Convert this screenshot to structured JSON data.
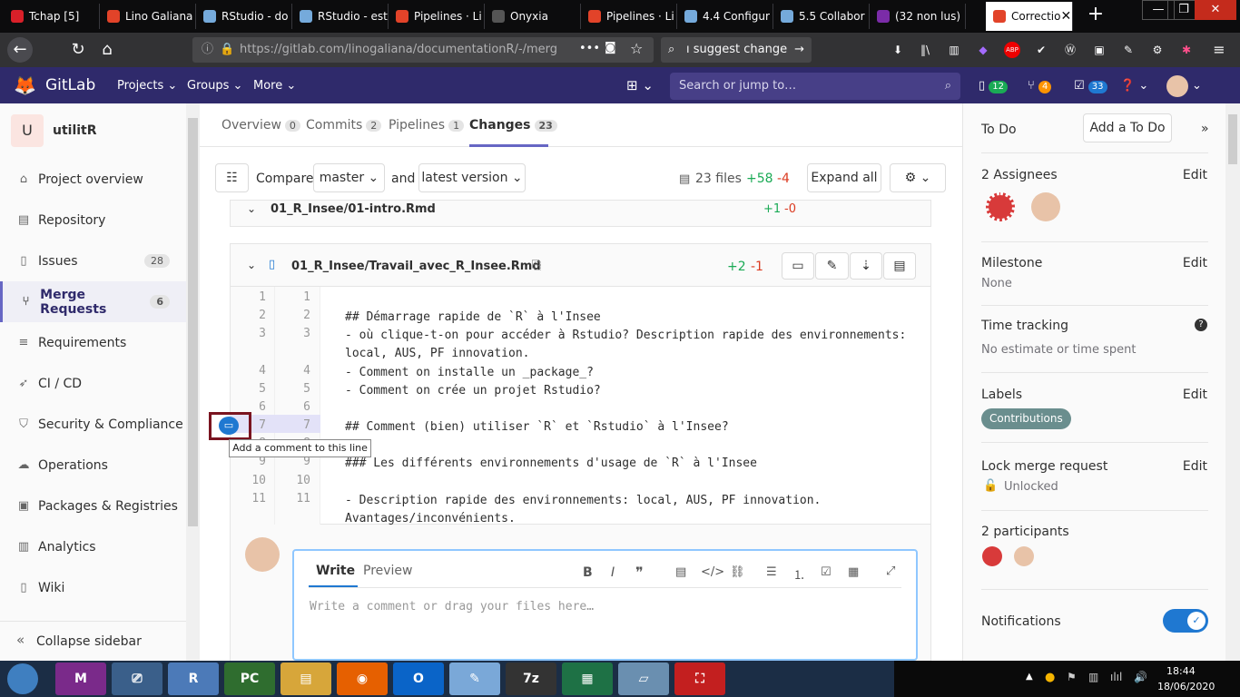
{
  "browser": {
    "tabs": [
      {
        "label": "Tchap [5]",
        "icon": "tchap-icon",
        "color": "#d92029"
      },
      {
        "label": "Lino Galiana",
        "icon": "gitlab-icon",
        "color": "#e24329"
      },
      {
        "label": "RStudio - do",
        "icon": "rstudio-icon",
        "color": "#75aadb"
      },
      {
        "label": "RStudio - est",
        "icon": "rstudio-icon",
        "color": "#75aadb"
      },
      {
        "label": "Pipelines · Li",
        "icon": "gitlab-icon",
        "color": "#e24329"
      },
      {
        "label": "Onyxia",
        "icon": "onyxia-icon",
        "color": "#555555"
      },
      {
        "label": "Pipelines · Li",
        "icon": "gitlab-icon",
        "color": "#e24329"
      },
      {
        "label": "4.4 Configur",
        "icon": "rstudio-icon",
        "color": "#75aadb"
      },
      {
        "label": "5.5 Collabor",
        "icon": "rstudio-icon",
        "color": "#75aadb"
      },
      {
        "label": "(32 non lus)",
        "icon": "mail-icon",
        "color": "#7b2ca8"
      },
      {
        "label": "Correctio",
        "icon": "gitlab-icon",
        "color": "#e24329"
      }
    ],
    "url": "https://gitlab.com/linogaliana/documentationR/-/merg",
    "url_host": "gitlab.com",
    "search": "ı suggest change"
  },
  "gitlab": {
    "brand": "GitLab",
    "nav": [
      "Projects",
      "Groups",
      "More"
    ],
    "search_placeholder": "Search or jump to…",
    "counts": {
      "mr": "12",
      "issues": "4",
      "todos": "33"
    }
  },
  "sidebar": {
    "project_initial": "U",
    "project": "utilitR",
    "items": [
      {
        "label": "Project overview",
        "icon": "home-icon"
      },
      {
        "label": "Repository",
        "icon": "doc-icon"
      },
      {
        "label": "Issues",
        "icon": "issues-icon",
        "badge": "28"
      },
      {
        "label": "Merge Requests",
        "icon": "merge-icon",
        "badge": "6",
        "active": true
      },
      {
        "label": "Requirements",
        "icon": "list-icon"
      },
      {
        "label": "CI / CD",
        "icon": "rocket-icon"
      },
      {
        "label": "Security & Compliance",
        "icon": "shield-icon"
      },
      {
        "label": "Operations",
        "icon": "cloud-icon"
      },
      {
        "label": "Packages & Registries",
        "icon": "package-icon"
      },
      {
        "label": "Analytics",
        "icon": "chart-icon"
      },
      {
        "label": "Wiki",
        "icon": "book-icon"
      }
    ],
    "collapse": "Collapse sidebar"
  },
  "mr": {
    "tabs": [
      {
        "label": "Overview",
        "count": "0"
      },
      {
        "label": "Commits",
        "count": "2"
      },
      {
        "label": "Pipelines",
        "count": "1"
      },
      {
        "label": "Changes",
        "count": "23"
      }
    ],
    "compare_label": "Compare",
    "compare_from": "master",
    "and_label": "and",
    "compare_to": "latest version",
    "files_summary": "23 files",
    "added": "+58",
    "removed": "-4",
    "expand_all": "Expand all",
    "prev_file": {
      "name": "01_R_Insee/01-intro.Rmd",
      "added": "+1",
      "removed": "-0"
    },
    "file": {
      "name": "01_R_Insee/Travail_avec_R_Insee.Rmd",
      "added": "+2",
      "removed": "-1"
    },
    "lines": [
      {
        "old": "1",
        "new": "1",
        "text": ""
      },
      {
        "old": "2",
        "new": "2",
        "text": "## Démarrage rapide de `R` à l'Insee"
      },
      {
        "old": "3",
        "new": "3",
        "text": "- où clique-t-on pour accéder à Rstudio? Description rapide des environnements:\nlocal, AUS, PF innovation."
      },
      {
        "old": "4",
        "new": "4",
        "text": "- Comment on installe un _package_?"
      },
      {
        "old": "5",
        "new": "5",
        "text": "- Comment on crée un projet Rstudio?"
      },
      {
        "old": "6",
        "new": "6",
        "text": ""
      },
      {
        "old": "7",
        "new": "7",
        "text": "## Comment (bien) utiliser `R` et `Rstudio` à l'Insee?"
      },
      {
        "old": "8",
        "new": "8",
        "text": ""
      },
      {
        "old": "9",
        "new": "9",
        "text": "### Les différents environnements d'usage de `R` à l'Insee"
      },
      {
        "old": "10",
        "new": "10",
        "text": ""
      },
      {
        "old": "11",
        "new": "11",
        "text": "- Description rapide des environnements: local, AUS, PF innovation.\nAvantages/inconvénients."
      }
    ],
    "tooltip": "Add a comment to this line",
    "comment": {
      "write_tab": "Write",
      "preview_tab": "Preview",
      "placeholder": "Write a comment or drag your files here…"
    }
  },
  "right": {
    "todo_label": "To Do",
    "add_todo": "Add a To Do",
    "assignees": "2 Assignees",
    "edit": "Edit",
    "milestone": "Milestone",
    "milestone_value": "None",
    "time_tracking": "Time tracking",
    "time_value": "No estimate or time spent",
    "labels": "Labels",
    "label_value": "Contributions",
    "lock": "Lock merge request",
    "lock_value": "Unlocked",
    "participants": "2 participants",
    "notifications": "Notifications"
  },
  "taskbar": {
    "apps": [
      "ma-icon",
      "device-icon",
      "R",
      "PC",
      "files-icon",
      "firefox-icon",
      "O",
      "paint-icon",
      "7z",
      "excel-icon",
      "notepad-icon",
      "pdf-icon"
    ],
    "time": "18:44",
    "date": "18/06/2020"
  }
}
